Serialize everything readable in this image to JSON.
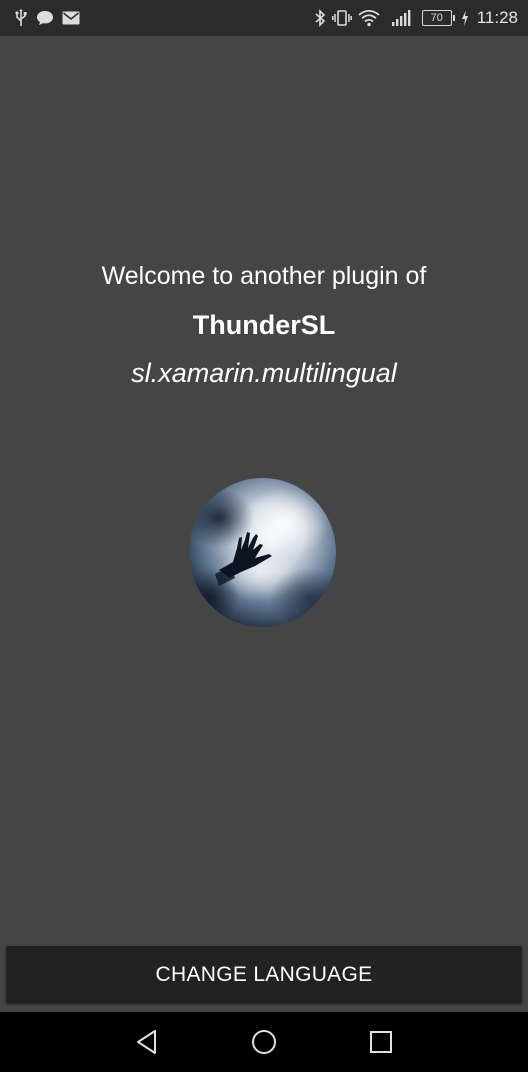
{
  "status_bar": {
    "left_icons": [
      "usb-icon",
      "chat-icon",
      "mail-icon"
    ],
    "right_icons": [
      "bluetooth-icon",
      "vibrate-icon",
      "wifi-icon",
      "signal-icon"
    ],
    "battery_level": "70",
    "time": "11:28"
  },
  "main": {
    "welcome_text": "Welcome to another plugin of",
    "brand": "ThunderSL",
    "package_name": "sl.xamarin.multilingual"
  },
  "actions": {
    "change_language_label": "CHANGE LANGUAGE"
  },
  "nav_bar": {
    "icons": [
      "back-icon",
      "home-icon",
      "recents-icon"
    ]
  },
  "colors": {
    "background": "#454545",
    "status_bar": "#2b2b2b",
    "button": "#222222",
    "nav_bar": "#000000"
  }
}
